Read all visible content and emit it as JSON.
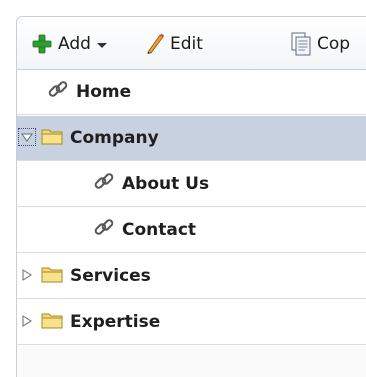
{
  "toolbar": {
    "add_label": "Add",
    "edit_label": "Edit",
    "copy_label": "Cop"
  },
  "tree": {
    "items": [
      {
        "label": "Home",
        "type": "link",
        "level": 1,
        "selected": false
      },
      {
        "label": "Company",
        "type": "folder",
        "level": 0,
        "expanded": true,
        "selected": true
      },
      {
        "label": "About Us",
        "type": "link",
        "level": 2,
        "selected": false
      },
      {
        "label": "Contact",
        "type": "link",
        "level": 2,
        "selected": false
      },
      {
        "label": "Services",
        "type": "folder",
        "level": 0,
        "expanded": false,
        "selected": false
      },
      {
        "label": "Expertise",
        "type": "folder",
        "level": 0,
        "expanded": false,
        "selected": false
      }
    ]
  },
  "icons": {
    "add": "plus-icon",
    "edit": "pencil-icon",
    "copy": "copy-icon",
    "link": "chain-link-icon",
    "folder": "folder-icon",
    "expanded": "triangle-down-icon",
    "collapsed": "triangle-right-icon"
  },
  "colors": {
    "selection": "#c8d1df",
    "add_green": "#2e9e2e",
    "folder": "#f2d970",
    "row_divider": "#d9dde2"
  }
}
